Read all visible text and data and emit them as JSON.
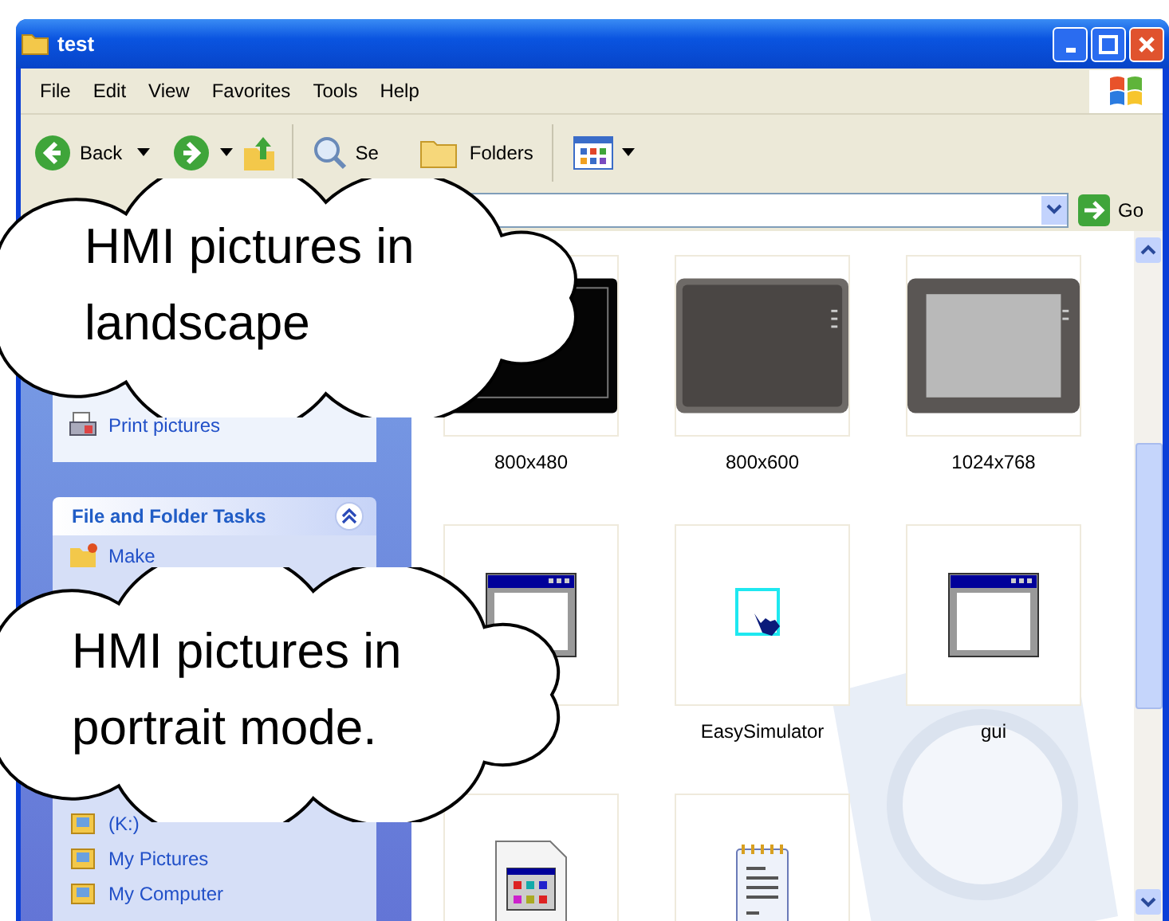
{
  "window": {
    "title": "test"
  },
  "menu": [
    "File",
    "Edit",
    "View",
    "Favorites",
    "Tools",
    "Help"
  ],
  "toolbar": {
    "back": "Back",
    "search": "Se",
    "folders": "Folders"
  },
  "address": {
    "go": "Go"
  },
  "sidebar": {
    "picture_tasks": [
      "Print pictures"
    ],
    "file_tasks": {
      "title": "File and Folder Tasks",
      "expanded": true,
      "items": [
        "Make"
      ]
    },
    "other_places": [
      "(K:)",
      "My Pictures",
      "My Computer"
    ]
  },
  "files": [
    {
      "kind": "hmi-black",
      "label": "800x480"
    },
    {
      "kind": "hmi-dark",
      "label": "800x600"
    },
    {
      "kind": "hmi-screen",
      "label": "1024x768"
    },
    {
      "kind": "window"
    },
    {
      "kind": "simulator",
      "label": "EasySimulator"
    },
    {
      "kind": "window",
      "label": "gui"
    },
    {
      "kind": "app-file"
    },
    {
      "kind": "notepad"
    }
  ],
  "callouts": [
    {
      "text": "HMI pictures in landscape"
    },
    {
      "text": "HMI pictures in portrait mode."
    }
  ]
}
